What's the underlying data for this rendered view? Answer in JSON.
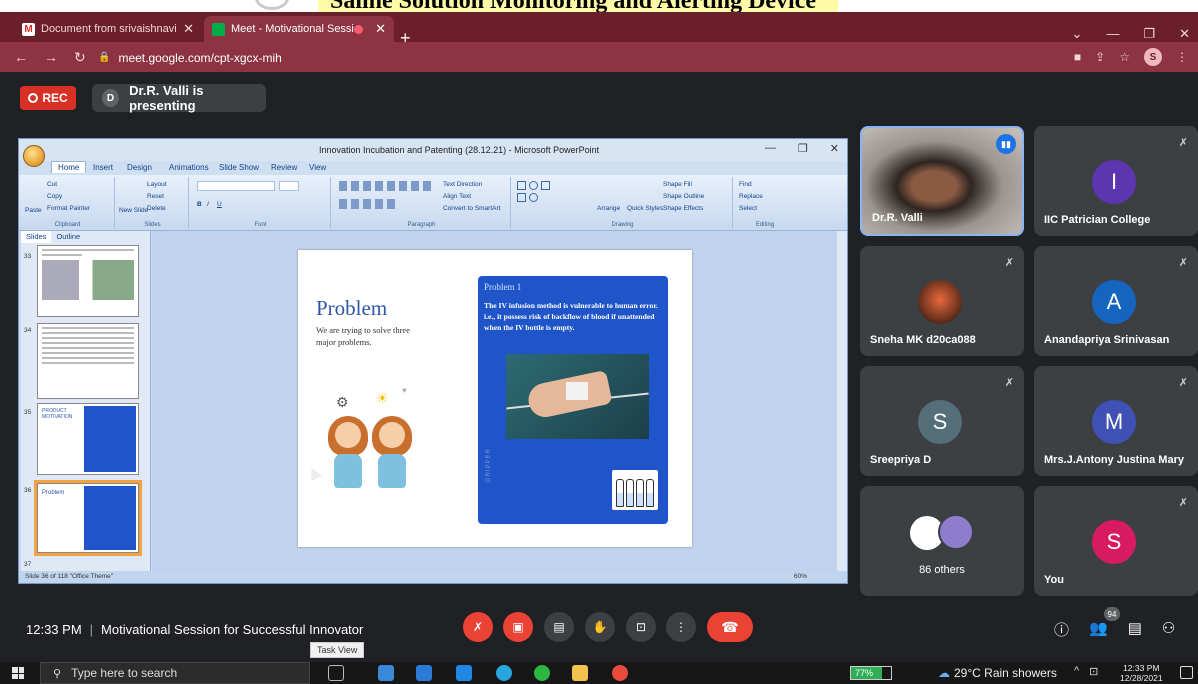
{
  "overlay": {
    "heading": "Saline Solution Monitoring and Alerting Device"
  },
  "browser": {
    "tabs": [
      {
        "label": "Document from srivaishnavisuresh",
        "active": false
      },
      {
        "label": "Meet - Motivational Session",
        "active": true
      }
    ],
    "url": "meet.google.com/cpt-xgcx-mih",
    "profile_initial": "S"
  },
  "meet": {
    "rec_label": "REC",
    "presenter_initial": "D",
    "presenting_text": "Dr.R. Valli is presenting",
    "meeting_time": "12:33 PM",
    "meeting_title": "Motivational Session for Successful Innovator",
    "people_count": "94",
    "tooltip": "Task View"
  },
  "ppt": {
    "window_title": "Innovation Incubation and Patenting (28.12.21) - Microsoft PowerPoint",
    "ribbon_tabs": [
      "Home",
      "Insert",
      "Design",
      "Animations",
      "Slide Show",
      "Review",
      "View"
    ],
    "groups": {
      "clipboard": {
        "label": "Clipboard",
        "paste": "Paste",
        "cut": "Cut",
        "copy": "Copy",
        "format_painter": "Format Painter"
      },
      "slides": {
        "label": "Slides",
        "new_slide": "New Slide",
        "layout": "Layout",
        "reset": "Reset",
        "delete": "Delete"
      },
      "font": {
        "label": "Font"
      },
      "paragraph": {
        "label": "Paragraph",
        "text_direction": "Text Direction",
        "align_text": "Align Text",
        "smartart": "Convert to SmartArt"
      },
      "drawing": {
        "label": "Drawing",
        "arrange": "Arrange",
        "quick_styles": "Quick Styles",
        "shape_fill": "Shape Fill",
        "shape_outline": "Shape Outline",
        "shape_effects": "Shape Effects"
      },
      "editing": {
        "label": "Editing",
        "find": "Find",
        "replace": "Replace",
        "select": "Select"
      }
    },
    "pane_tabs": [
      "Slides",
      "Outline"
    ],
    "thumb_numbers": [
      "33",
      "34",
      "35",
      "36",
      "37"
    ],
    "thumb_labels": {
      "motivation": "PRODUCT MOTIVATION",
      "problem": "Problem"
    },
    "status": "Slide 36 of 118   \"Office Theme\"",
    "zoom": "60%",
    "slide": {
      "title": "Problem",
      "subtitle": "We are trying to solve three major problems.",
      "card_heading": "Problem 1",
      "card_text": "The IV infusion method is vulnerable to human error. i.e., it possess risk of backflow of blood if unattended when the IV bottle is empty.",
      "vertical_label": "DRIPPER"
    }
  },
  "participants": [
    {
      "name": "Dr.R. Valli",
      "initial": "",
      "color": "",
      "video": true
    },
    {
      "name": "IIC Patrician College",
      "initial": "I",
      "color": "#5e35b1"
    },
    {
      "name": "Sneha MK d20ca088",
      "initial": "",
      "color": ""
    },
    {
      "name": "Anandapriya Srinivasan",
      "initial": "A",
      "color": "#1565c0"
    },
    {
      "name": "Sreepriya D",
      "initial": "S",
      "color": "#546e7a"
    },
    {
      "name": "Mrs.J.Antony Justina Mary",
      "initial": "M",
      "color": "#3f51b5"
    },
    {
      "name": "86 others",
      "initial": "",
      "color": ""
    },
    {
      "name": "You",
      "initial": "S",
      "color": "#d81b60"
    }
  ],
  "taskbar": {
    "search_placeholder": "Type here to search",
    "battery": "77%",
    "weather": "29°C  Rain showers",
    "time": "12:33 PM",
    "date": "12/28/2021"
  }
}
